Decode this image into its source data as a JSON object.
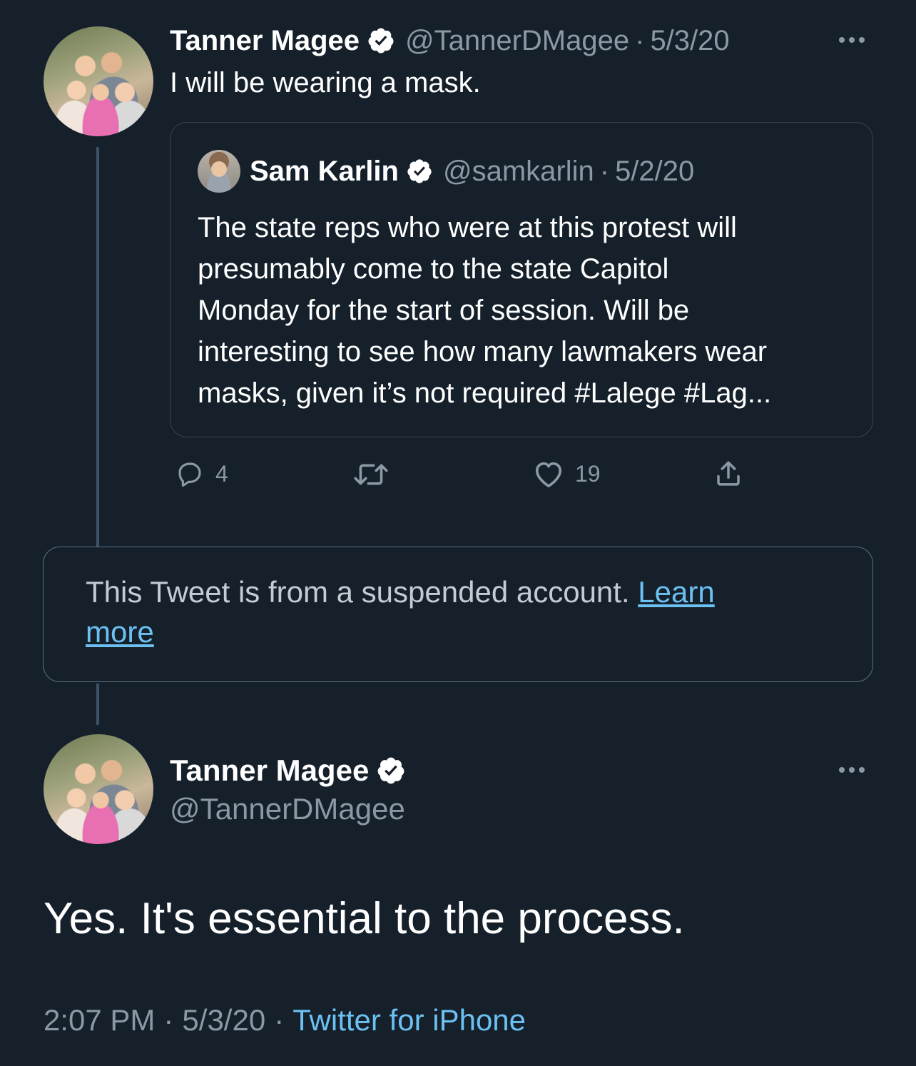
{
  "first_tweet": {
    "author_name": "Tanner Magee",
    "author_handle": "@TannerDMagee",
    "date": "5/3/20",
    "text": "I will be wearing a mask.",
    "quoted": {
      "author_name": "Sam Karlin",
      "author_handle": "@samkarlin",
      "date": "5/2/20",
      "lines": [
        "The state reps who were at this protest will",
        "presumably come to the state Capitol",
        "Monday for the start of session. Will be",
        "interesting to see how many lawmakers wear",
        "masks, given it’s not required #Lalege #Lag..."
      ]
    },
    "reply_count": "4",
    "like_count": "19"
  },
  "suspended": {
    "text": "This Tweet is from a suspended account.",
    "link_line1": "Learn",
    "link_line2": "more"
  },
  "main_tweet": {
    "author_name": "Tanner Magee",
    "author_handle": "@TannerDMagee",
    "text": "Yes. It's essential to the process.",
    "time": "2:07 PM",
    "date": "5/3/20",
    "source": "Twitter for iPhone"
  },
  "separator": "·",
  "colors": {
    "background": "#15202b",
    "link": "#6cc1f2",
    "muted": "#8b98a5",
    "border": "#38444d"
  },
  "icons": [
    "verified-badge-icon",
    "more-icon",
    "reply-icon",
    "retweet-icon",
    "like-icon",
    "share-icon"
  ]
}
